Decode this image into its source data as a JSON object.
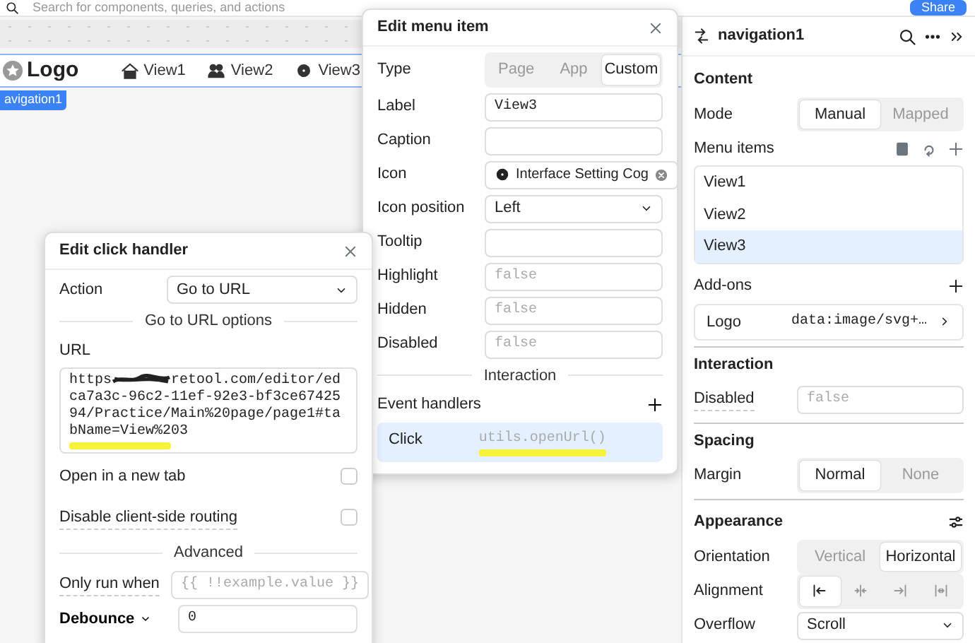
{
  "top_bar": {
    "search_placeholder": "Search for components, queries, and actions",
    "share_button": "Share"
  },
  "canvas": {
    "logo": "Logo",
    "selection_tag": "avigation1",
    "nav_items": [
      {
        "label": "View1"
      },
      {
        "label": "View2"
      },
      {
        "label": "View3"
      }
    ]
  },
  "edit_menu_item": {
    "title": "Edit menu item",
    "rows": [
      {
        "kind": "segmented",
        "label": "Type",
        "options": [
          {
            "label": "Page",
            "selected": false
          },
          {
            "label": "App",
            "selected": false
          },
          {
            "label": "Custom",
            "selected": true
          }
        ]
      },
      {
        "kind": "input",
        "label": "Label",
        "value": "View3"
      },
      {
        "kind": "input",
        "label": "Caption"
      },
      {
        "kind": "icon",
        "label": "Icon",
        "value": "Interface Setting Cog"
      },
      {
        "kind": "select",
        "label": "Icon position",
        "value": "Left"
      },
      {
        "kind": "input",
        "label": "Tooltip"
      },
      {
        "kind": "input",
        "label": "Highlight",
        "placeholder": "false"
      },
      {
        "kind": "input",
        "label": "Hidden",
        "placeholder": "false"
      },
      {
        "kind": "input",
        "label": "Disabled",
        "placeholder": "false"
      }
    ],
    "section": "Interaction",
    "event_handlers_label": "Event handlers",
    "handlers": [
      {
        "event": "Click",
        "action": "utils.openUrl()"
      }
    ]
  },
  "edit_click_handler": {
    "title": "Edit click handler",
    "action_label": "Action",
    "action_value": "Go to URL",
    "options_section": "Go to URL options",
    "url_label": "URL",
    "url_prefix": "https",
    "url_rest": "retool.com/editor/edca7a3c-96c2-11ef-92e3-bf3ce6742594/Practice/Main%20page/page1#tabName=View%203",
    "checkboxes": [
      {
        "label": "Open in a new tab",
        "checked": false
      },
      {
        "label": "Disable client-side routing",
        "checked": false
      }
    ],
    "advanced_section": "Advanced",
    "only_run_label": "Only run when",
    "only_run_placeholder": "{{ !!example.value }}",
    "debounce_label": "Debounce",
    "debounce_value": "0"
  },
  "inspector": {
    "title": "navigation1",
    "content_title": "Content",
    "mode_label": "Mode",
    "mode_options": [
      {
        "label": "Manual",
        "selected": true
      },
      {
        "label": "Mapped",
        "selected": false
      }
    ],
    "menu_items_label": "Menu items",
    "menu_items": [
      {
        "label": "View1",
        "selected": false
      },
      {
        "label": "View2",
        "selected": false
      },
      {
        "label": "View3",
        "selected": true
      }
    ],
    "addons_label": "Add-ons",
    "addons": [
      {
        "label": "Logo",
        "value": "data:image/svg+…"
      }
    ],
    "interaction_title": "Interaction",
    "disabled_label": "Disabled",
    "disabled_placeholder": "false",
    "spacing_title": "Spacing",
    "margin_label": "Margin",
    "margin_options": [
      {
        "label": "Normal",
        "selected": true
      },
      {
        "label": "None",
        "selected": false
      }
    ],
    "appearance_title": "Appearance",
    "orientation_label": "Orientation",
    "orientation_options": [
      {
        "label": "Vertical",
        "selected": false
      },
      {
        "label": "Horizontal",
        "selected": true
      }
    ],
    "alignment_label": "Alignment",
    "alignment_options": [
      {
        "selected": true
      },
      {
        "selected": false
      },
      {
        "selected": false
      },
      {
        "selected": false
      }
    ],
    "overflow_label": "Overflow",
    "overflow_value": "Scroll"
  }
}
